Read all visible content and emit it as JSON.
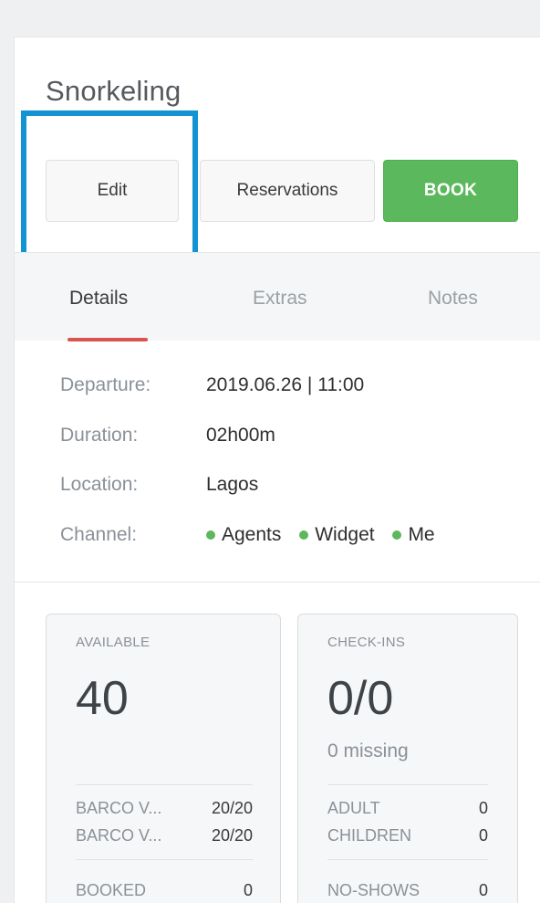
{
  "page": {
    "title": "Snorkeling"
  },
  "actions": {
    "edit": "Edit",
    "reservations": "Reservations",
    "book": "BOOK"
  },
  "tabs": [
    {
      "label": "Details",
      "active": true
    },
    {
      "label": "Extras",
      "active": false
    },
    {
      "label": "Notes",
      "active": false
    }
  ],
  "details": {
    "departure_label": "Departure:",
    "departure_value": "2019.06.26 | 11:00",
    "duration_label": "Duration:",
    "duration_value": "02h00m",
    "location_label": "Location:",
    "location_value": "Lagos",
    "channel_label": "Channel:",
    "channels": [
      {
        "label": "Agents",
        "color": "#5cb85c"
      },
      {
        "label": "Widget",
        "color": "#5cb85c"
      },
      {
        "label": "Me",
        "color": "#5cb85c"
      }
    ]
  },
  "available": {
    "label": "AVAILABLE",
    "value": "40",
    "rows": [
      {
        "label": "BARCO V...",
        "value": "20/20"
      },
      {
        "label": "BARCO V...",
        "value": "20/20"
      }
    ],
    "booked_label": "BOOKED",
    "booked_value": "0"
  },
  "checkins": {
    "label": "CHECK-INS",
    "value": "0/0",
    "missing": "0 missing",
    "rows": [
      {
        "label": "ADULT",
        "value": "0"
      },
      {
        "label": "CHILDREN",
        "value": "0"
      }
    ],
    "noshows_label": "NO-SHOWS",
    "noshows_value": "0"
  },
  "colors": {
    "book": "#5cb85c",
    "tab_active": "#d9534f",
    "highlight": "#1493d3"
  }
}
